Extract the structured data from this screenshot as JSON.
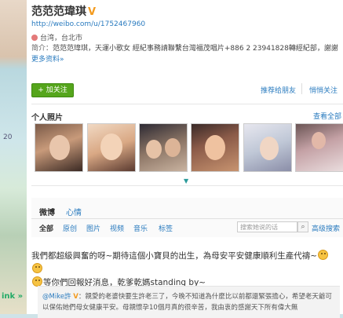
{
  "profile": {
    "name": "范范范瑋琪",
    "verified_badge": "V",
    "url": "http://weibo.com/u/1752467960",
    "location": "台湾，台北市",
    "bio_label": "简介：",
    "bio_text": "范范范瑋琪，天運小歌女 經紀事務請聯繫台灣福茂唱片+886 2 23941828轉經紀部，謝謝",
    "bio_more": "更多资料»"
  },
  "actions": {
    "follow": "+ 加关注",
    "recommend": "推荐给朋友",
    "unfollow": "悄悄关注"
  },
  "photos": {
    "title": "个人照片",
    "see_all": "查看全部"
  },
  "feed": {
    "tabs": [
      "微博",
      "心情"
    ],
    "filters": [
      "全部",
      "原创",
      "图片",
      "视频",
      "音乐",
      "标签"
    ],
    "search_placeholder": "搜索她说的话",
    "advanced_search": "高级搜索"
  },
  "post": {
    "text1": "我們都超級興奮的呀~期待這個小寶貝的出生，為母安平安健康順利生產代禱~",
    "text2": "等你們回報好消息，乾爹乾媽standing by~"
  },
  "repost": {
    "user": "@Mike許",
    "badge": "V",
    "text": "：親愛的老婆快要生許老三了，今晚不知道為什麼比以前都還緊張擔心，希望老天爺可以保佑她們母女健康平安。母親懷孕10個月真的很辛苦，我由衷的感謝天下所有偉大無"
  },
  "background": {
    "edge_text": "20",
    "more_text": "ink »"
  }
}
